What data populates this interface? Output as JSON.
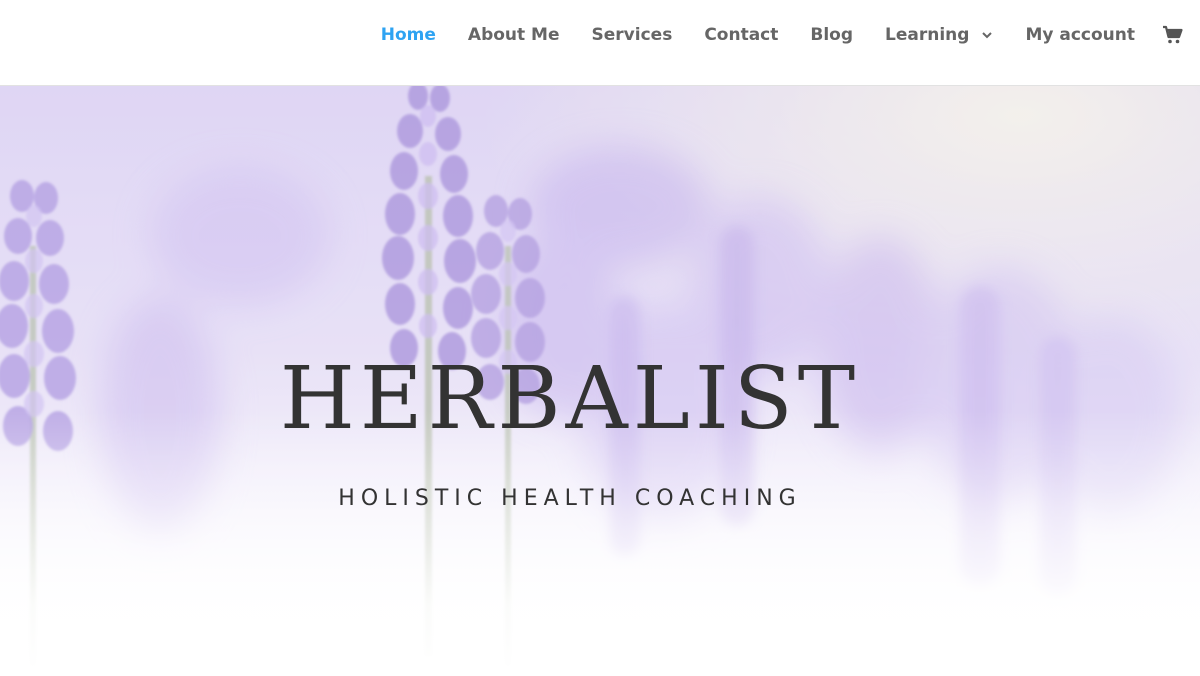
{
  "nav": {
    "items": [
      {
        "label": "Home",
        "active": true
      },
      {
        "label": "About Me",
        "active": false
      },
      {
        "label": "Services",
        "active": false
      },
      {
        "label": "Contact",
        "active": false
      },
      {
        "label": "Blog",
        "active": false
      },
      {
        "label": "Learning",
        "active": false,
        "has_dropdown": true
      },
      {
        "label": "My account",
        "active": false
      }
    ],
    "cart_icon": "shopping-cart-icon"
  },
  "hero": {
    "title": "HERBALIST",
    "subtitle": "HOLISTIC HEALTH COACHING",
    "background": "lavender-field-photo"
  },
  "colors": {
    "accent": "#2ea3f2",
    "nav_text": "#666666",
    "hero_text": "#333333",
    "lavender": "#b8a2e8"
  }
}
